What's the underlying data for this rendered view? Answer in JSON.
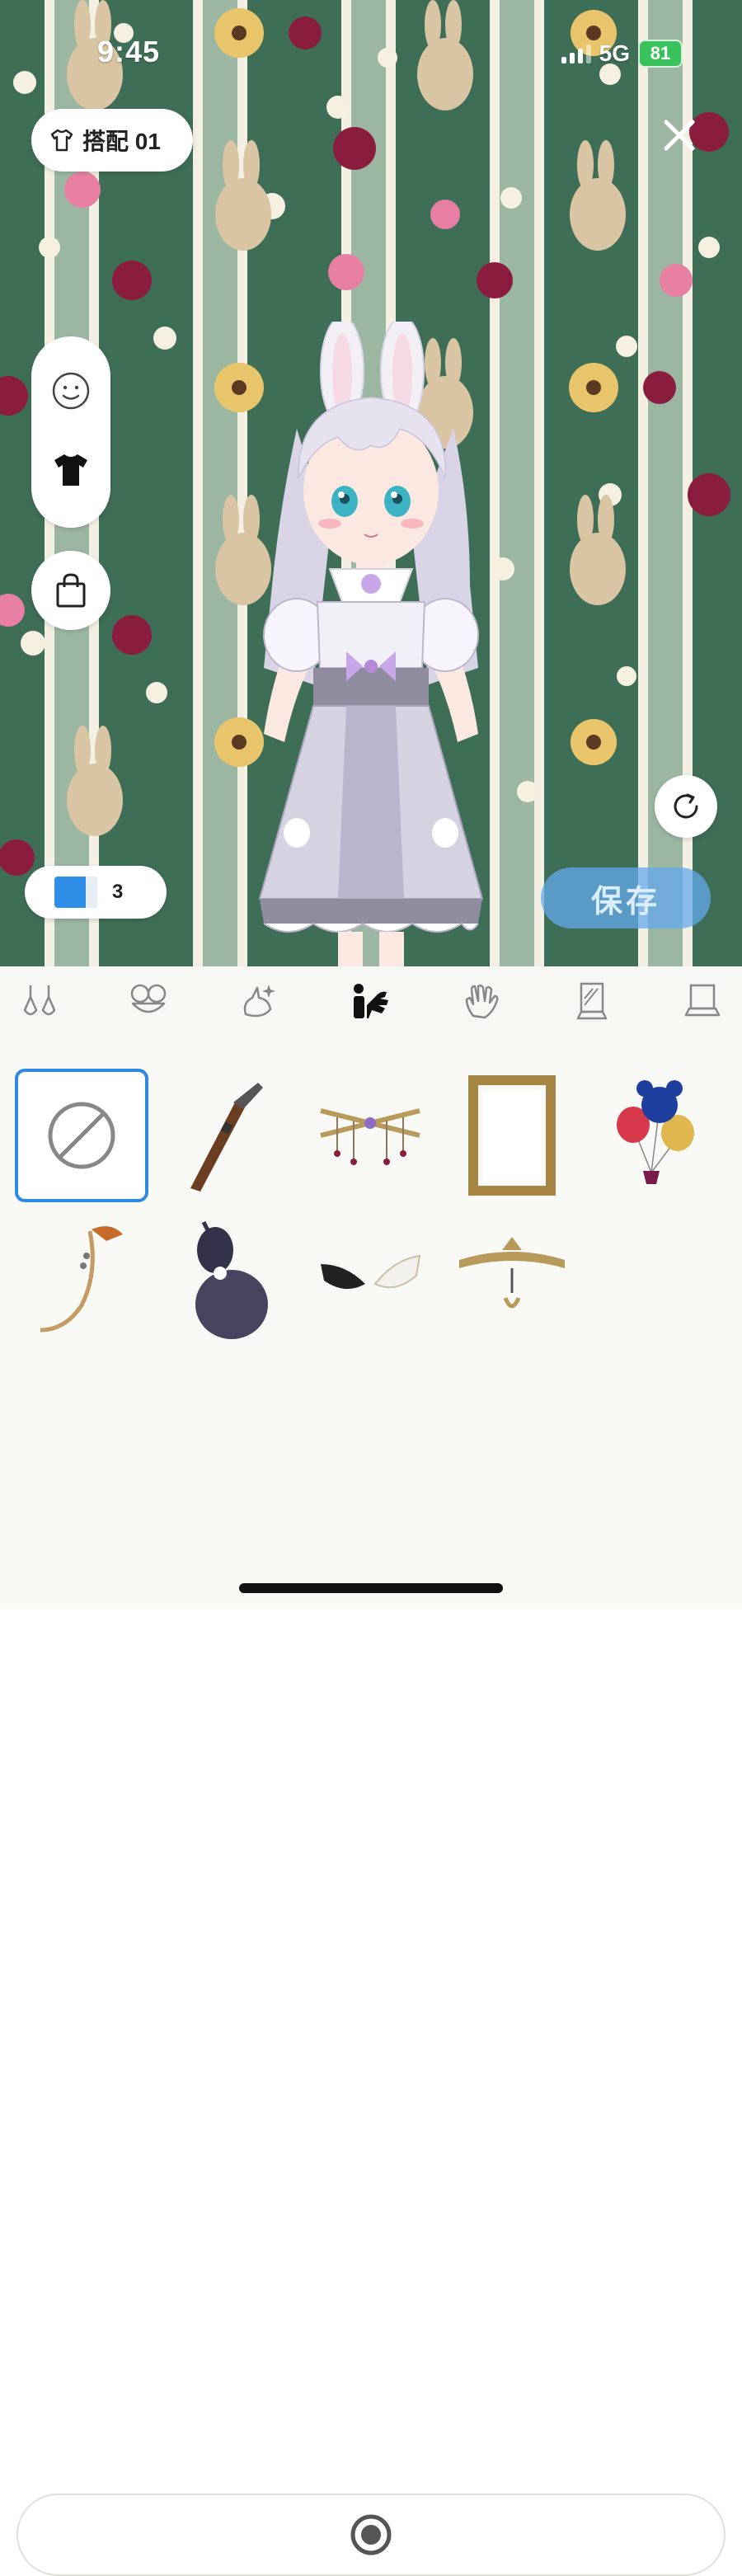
{
  "status_bar": {
    "time": "9:45",
    "network": "5G",
    "battery": "81"
  },
  "outfit": {
    "label": "搭配 01"
  },
  "ticket": {
    "count": "3"
  },
  "save_button": {
    "label": "保存"
  },
  "colors": {
    "accent": "#2f8ae6",
    "wallpaper_dark": "#3f6e57",
    "wallpaper_light": "#9bb7a2",
    "battery": "#39c15b"
  },
  "side_toolbar": {
    "items": [
      "face-icon",
      "shirt-icon"
    ]
  },
  "tabs": [
    {
      "icon": "earrings-icon"
    },
    {
      "icon": "mask-icon"
    },
    {
      "icon": "effect-icon"
    },
    {
      "icon": "pose-icon",
      "selected": true
    },
    {
      "icon": "hand-icon"
    },
    {
      "icon": "frame-stand-icon"
    },
    {
      "icon": "laptop-icon"
    }
  ],
  "items": [
    {
      "icon": "none-icon",
      "selected": true
    },
    {
      "icon": "rifle-icon"
    },
    {
      "icon": "chain-icon"
    },
    {
      "icon": "picture-frame-icon"
    },
    {
      "icon": "balloons-icon"
    },
    {
      "icon": "tail-icon"
    },
    {
      "icon": "gourd-icon"
    },
    {
      "icon": "wings-icon"
    },
    {
      "icon": "tiara-icon"
    }
  ],
  "bottom_bar": {
    "icon": "record-icon"
  }
}
